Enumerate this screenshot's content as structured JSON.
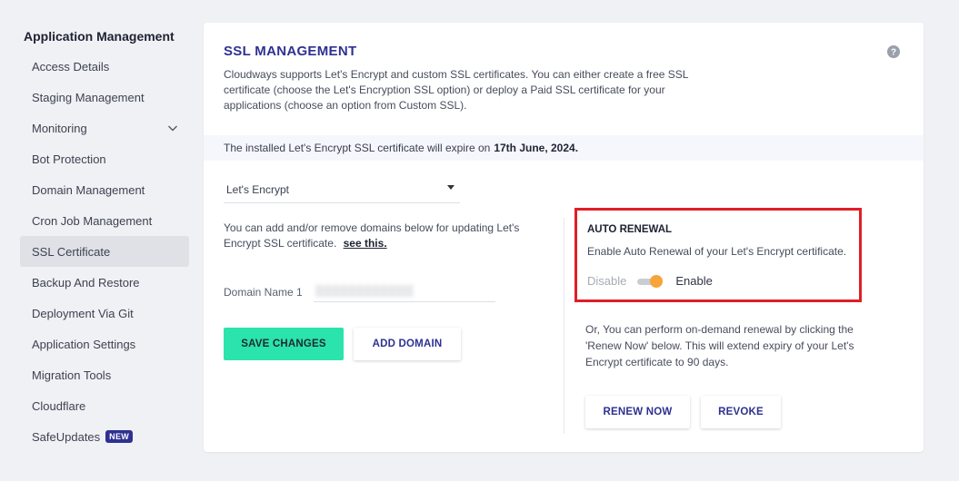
{
  "sidebar": {
    "title": "Application Management",
    "items": [
      {
        "label": "Access Details"
      },
      {
        "label": "Staging Management"
      },
      {
        "label": "Monitoring"
      },
      {
        "label": "Bot Protection"
      },
      {
        "label": "Domain Management"
      },
      {
        "label": "Cron Job Management"
      },
      {
        "label": "SSL Certificate"
      },
      {
        "label": "Backup And Restore"
      },
      {
        "label": "Deployment Via Git"
      },
      {
        "label": "Application Settings"
      },
      {
        "label": "Migration Tools"
      },
      {
        "label": "Cloudflare"
      },
      {
        "label": "SafeUpdates",
        "badge": "NEW"
      }
    ],
    "active_item": "SSL Certificate"
  },
  "ssl": {
    "title": "SSL MANAGEMENT",
    "description": "Cloudways supports Let's Encrypt and custom SSL certificates. You can either create a free SSL certificate (choose the Let's Encryption SSL option) or deploy a Paid SSL certificate for your applications (choose an option from Custom SSL).",
    "expiry_text": "The installed Let's Encrypt SSL certificate will expire on",
    "expiry_date": "17th June, 2024.",
    "provider_select": "Let's Encrypt",
    "domains_note": "You can add and/or remove domains below for updating Let's Encrypt SSL certificate.",
    "domains_link": "see this.",
    "domain_label": "Domain Name 1",
    "save_button": "SAVE CHANGES",
    "add_domain_button": "ADD DOMAIN"
  },
  "auto_renewal": {
    "title": "AUTO RENEWAL",
    "description": "Enable Auto Renewal of your Let's Encrypt certificate.",
    "disable_label": "Disable",
    "enable_label": "Enable",
    "enabled": true,
    "renew_note": "Or, You can perform on-demand renewal by clicking the 'Renew Now' below. This will extend expiry of your Let's Encrypt certificate to 90 days.",
    "renew_button": "RENEW NOW",
    "revoke_button": "REVOKE"
  },
  "colors": {
    "accent": "#2e3192",
    "save_button": "#2be3ac",
    "toggle_on": "#f7a43a",
    "highlight_border": "#e01e26"
  },
  "icons": {
    "help": "question-circle-icon",
    "monitoring_expand": "chevron-down-icon",
    "select_caret": "caret-down-icon"
  }
}
